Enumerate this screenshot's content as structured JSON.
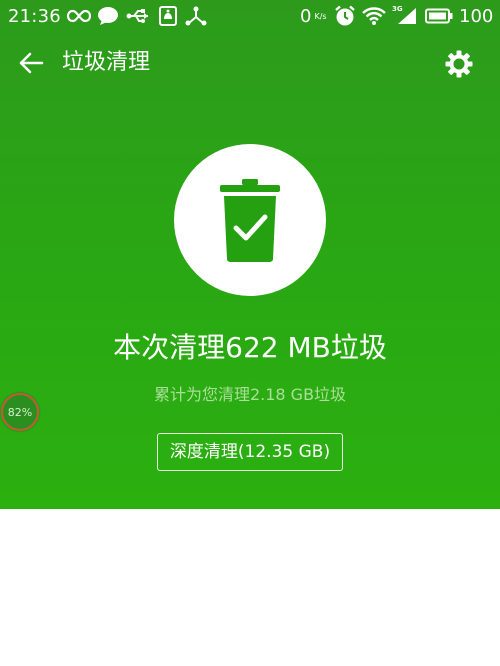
{
  "status_bar": {
    "time": "21:36",
    "net_speed": "0",
    "net_speed_unit": "K/s",
    "network_type": "3G",
    "battery_level": "100",
    "left_icons": [
      "infinity-icon",
      "chat-bubble-icon",
      "usb-icon",
      "notification-box-icon",
      "share-node-icon"
    ],
    "right_icons": [
      "alarm-clock-icon",
      "wifi-icon",
      "signal-icon",
      "battery-icon"
    ]
  },
  "app_bar": {
    "title": "垃圾清理",
    "back_icon": "arrow-left-icon",
    "settings_icon": "gear-icon"
  },
  "hero": {
    "icon": "trash-check-icon",
    "result_title": "本次清理622 MB垃圾",
    "total_text": "累计为您清理2.18 GB垃圾",
    "deep_clean_label": "深度清理(12.35 GB)"
  },
  "float_bubble": {
    "percent_label": "82%"
  },
  "colors": {
    "primary_green": "#2aa614",
    "white": "#ffffff",
    "subtext_green": "#a9df98",
    "icon_green": "#25a010"
  }
}
